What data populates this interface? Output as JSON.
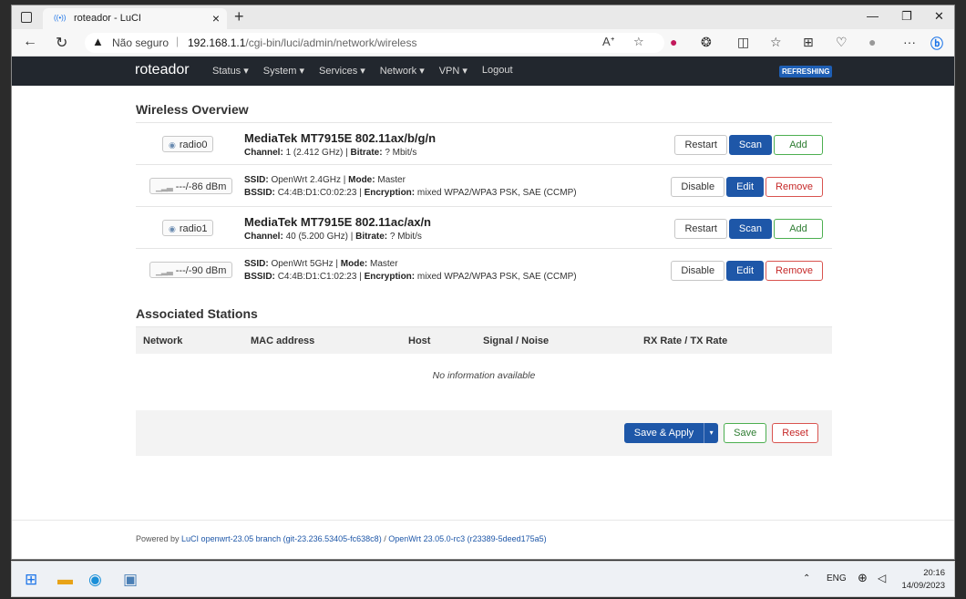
{
  "browser": {
    "tab_title": "roteador - LuCI",
    "tab_close": "×",
    "new_tab": "+",
    "insecure_label": "Não seguro",
    "url_host": "192.168.1.1",
    "url_path": "/cgi-bin/luci/admin/network/wireless"
  },
  "header": {
    "brand": "roteador",
    "menu": [
      "Status ▾",
      "System ▾",
      "Services ▾",
      "Network ▾",
      "VPN ▾",
      "Logout"
    ],
    "badge": "REFRESHING"
  },
  "wireless": {
    "title": "Wireless Overview",
    "radios": [
      {
        "device": "radio0",
        "name": "MediaTek MT7915E 802.11ax/b/g/n",
        "channel_label": "Channel:",
        "channel": "1 (2.412 GHz)",
        "bitrate_label": "Bitrate:",
        "bitrate": "? Mbit/s",
        "restart": "Restart",
        "scan": "Scan",
        "add": "Add",
        "iface": {
          "signal": "---/-86 dBm",
          "ssid_label": "SSID:",
          "ssid": "OpenWrt 2.4GHz",
          "mode_label": "Mode:",
          "mode": "Master",
          "bssid_label": "BSSID:",
          "bssid": "C4:4B:D1:C0:02:23",
          "enc_label": "Encryption:",
          "enc": "mixed WPA2/WPA3 PSK, SAE (CCMP)",
          "disable": "Disable",
          "edit": "Edit",
          "remove": "Remove"
        }
      },
      {
        "device": "radio1",
        "name": "MediaTek MT7915E 802.11ac/ax/n",
        "channel_label": "Channel:",
        "channel": "40 (5.200 GHz)",
        "bitrate_label": "Bitrate:",
        "bitrate": "? Mbit/s",
        "restart": "Restart",
        "scan": "Scan",
        "add": "Add",
        "iface": {
          "signal": "---/-90 dBm",
          "ssid_label": "SSID:",
          "ssid": "OpenWrt 5GHz",
          "mode_label": "Mode:",
          "mode": "Master",
          "bssid_label": "BSSID:",
          "bssid": "C4:4B:D1:C1:02:23",
          "enc_label": "Encryption:",
          "enc": "mixed WPA2/WPA3 PSK, SAE (CCMP)",
          "disable": "Disable",
          "edit": "Edit",
          "remove": "Remove"
        }
      }
    ]
  },
  "stations": {
    "title": "Associated Stations",
    "columns": [
      "Network",
      "MAC address",
      "Host",
      "Signal / Noise",
      "RX Rate / TX Rate"
    ],
    "empty": "No information available"
  },
  "actions": {
    "save_apply": "Save & Apply",
    "caret": "▾",
    "save": "Save",
    "reset": "Reset"
  },
  "footer": {
    "powered": "Powered by",
    "luci_link": "LuCI openwrt-23.05 branch (git-23.236.53405-fc638c8)",
    "sep": "/",
    "openwrt_link": "OpenWrt 23.05.0-rc3 (r23389-5deed175a5)"
  },
  "taskbar": {
    "lang": "ENG",
    "time": "20:16",
    "date": "14/09/2023"
  }
}
